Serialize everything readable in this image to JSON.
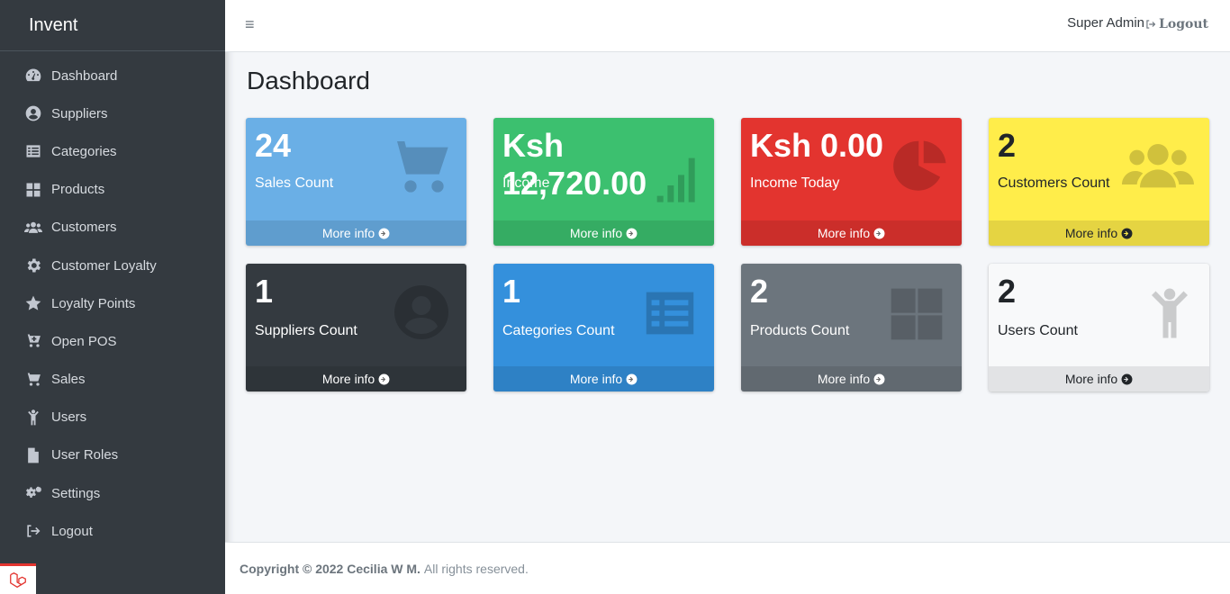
{
  "brand": "Invent",
  "sidebar": {
    "items": [
      {
        "label": "Dashboard",
        "icon": "tachometer-icon"
      },
      {
        "label": "Suppliers",
        "icon": "user-circle-icon"
      },
      {
        "label": "Categories",
        "icon": "list-alt-icon"
      },
      {
        "label": "Products",
        "icon": "th-large-icon"
      },
      {
        "label": "Customers",
        "icon": "users-icon"
      },
      {
        "label": "Customer Loyalty",
        "icon": "cog-icon"
      },
      {
        "label": "Loyalty Points",
        "icon": "star-icon"
      },
      {
        "label": "Open POS",
        "icon": "cart-plus-icon"
      },
      {
        "label": "Sales",
        "icon": "shopping-cart-icon"
      },
      {
        "label": "Users",
        "icon": "child-icon"
      },
      {
        "label": "User Roles",
        "icon": "file-icon"
      },
      {
        "label": "Settings",
        "icon": "cogs-icon"
      },
      {
        "label": "Logout",
        "icon": "sign-out-icon"
      }
    ]
  },
  "topbar": {
    "menu_icon": "≡",
    "user": "Super Admin",
    "logout": "Logout"
  },
  "page_title": "Dashboard",
  "boxes": [
    {
      "value": "24",
      "label": "Sales Count",
      "more": "More info",
      "color": "#6aafe6",
      "icon": "shopping-cart-icon"
    },
    {
      "value": "Ksh 12,720.00",
      "label": "Income",
      "more": "More info",
      "color": "#3cc06f",
      "icon": "signal-icon"
    },
    {
      "value": "Ksh 0.00",
      "label": "Income Today",
      "more": "More info",
      "color": "#e3342f",
      "icon": "pie-chart-icon"
    },
    {
      "value": "2",
      "label": "Customers Count",
      "more": "More info",
      "color": "#ffed4a",
      "icon": "users-icon"
    },
    {
      "value": "1",
      "label": "Suppliers Count",
      "more": "More info",
      "color": "#343a40",
      "icon": "user-circle-icon"
    },
    {
      "value": "1",
      "label": "Categories Count",
      "more": "More info",
      "color": "#3490dc",
      "icon": "list-alt-icon"
    },
    {
      "value": "2",
      "label": "Products Count",
      "more": "More info",
      "color": "#6c757d",
      "icon": "th-large-icon"
    },
    {
      "value": "2",
      "label": "Users Count",
      "more": "More info",
      "color": "#f8f9fa",
      "icon": "child-icon"
    }
  ],
  "footer": {
    "copyright": "Copyright © 2022 Cecilia W M.",
    "rights": "All rights reserved."
  }
}
